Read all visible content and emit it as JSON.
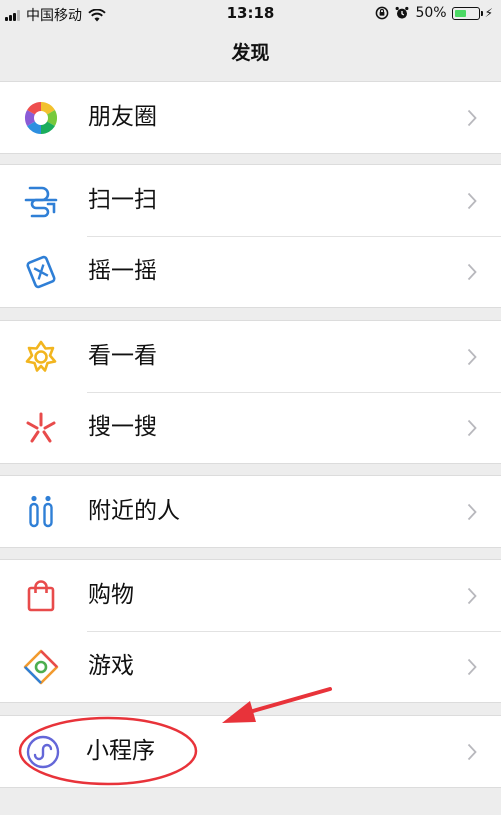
{
  "status_bar": {
    "carrier": "中国移动",
    "time": "13:18",
    "battery_percent": "50%",
    "battery_level": 0.5,
    "icons": [
      "signal-icon",
      "wifi-icon",
      "rotation-lock-icon",
      "alarm-icon",
      "battery-icon",
      "charging-bolt-icon"
    ]
  },
  "header": {
    "title": "发现"
  },
  "groups": [
    {
      "items": [
        {
          "label": "朋友圈",
          "icon": "moments-icon"
        }
      ]
    },
    {
      "items": [
        {
          "label": "扫一扫",
          "icon": "scan-icon"
        },
        {
          "label": "摇一摇",
          "icon": "shake-icon"
        }
      ]
    },
    {
      "items": [
        {
          "label": "看一看",
          "icon": "top-stories-icon"
        },
        {
          "label": "搜一搜",
          "icon": "search-icon"
        }
      ]
    },
    {
      "items": [
        {
          "label": "附近的人",
          "icon": "people-nearby-icon"
        }
      ]
    },
    {
      "items": [
        {
          "label": "购物",
          "icon": "shopping-bag-icon"
        },
        {
          "label": "游戏",
          "icon": "games-icon"
        }
      ]
    },
    {
      "items": [
        {
          "label": "小程序",
          "icon": "mini-program-icon"
        }
      ]
    }
  ],
  "annotation": {
    "color": "#e8333a",
    "shapes": [
      "red-ellipse-highlight",
      "red-arrow"
    ]
  }
}
